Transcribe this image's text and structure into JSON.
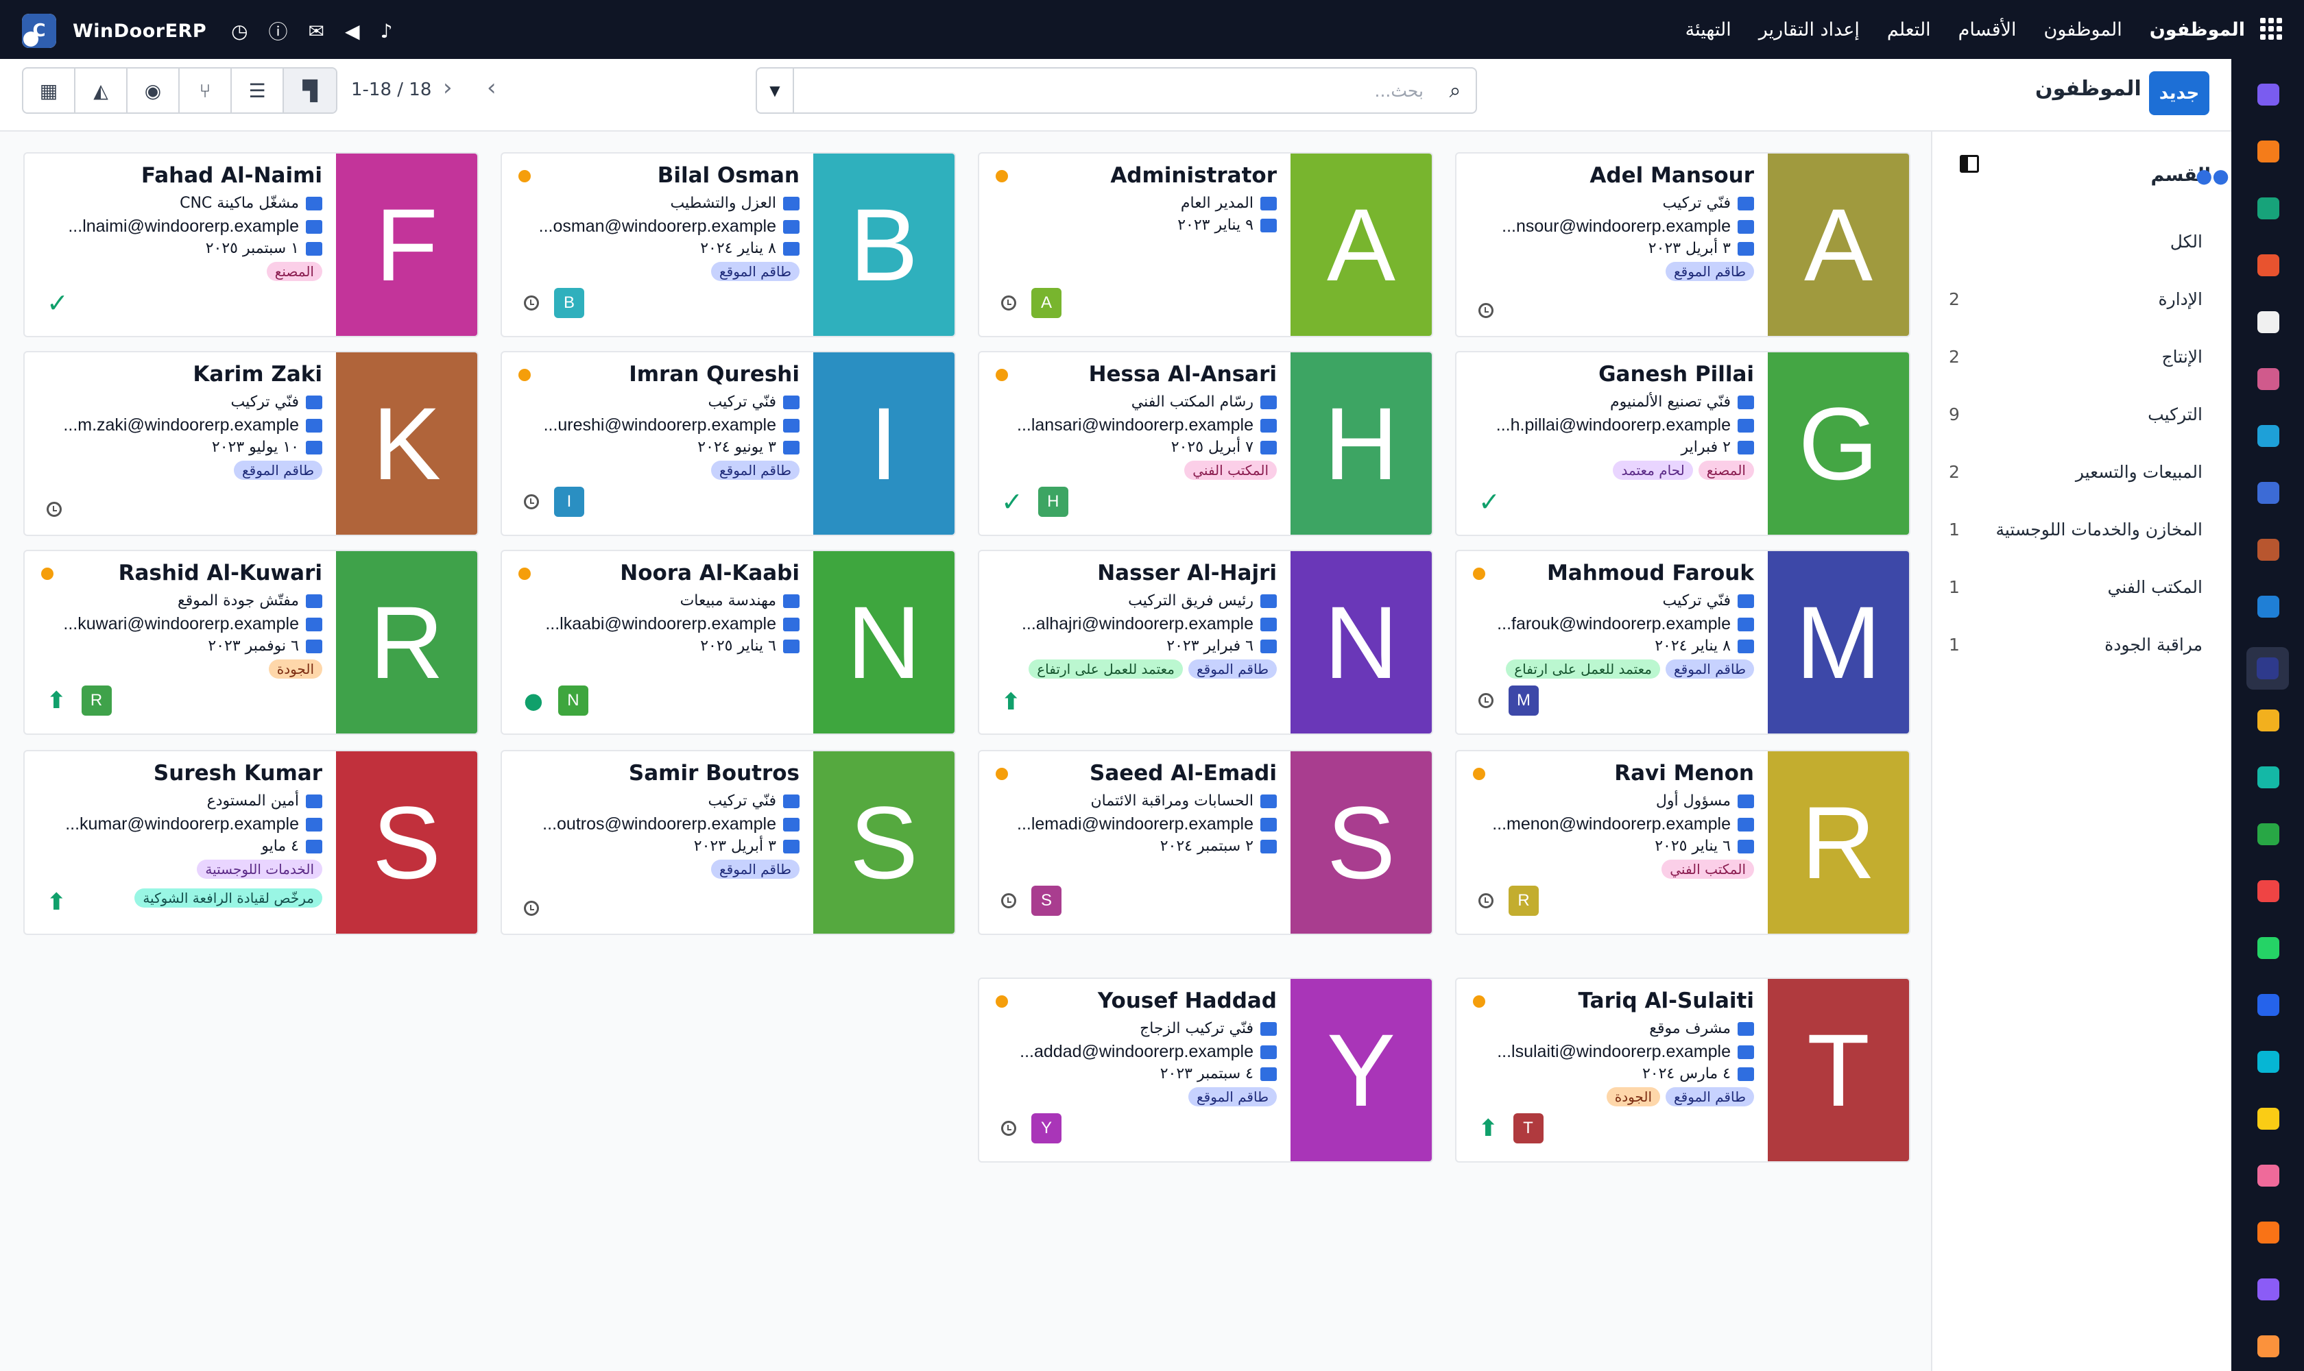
{
  "topbar": {
    "brand": "WinDoorERP",
    "menu": [
      "الموظفون",
      "الموظفون",
      "الأقسام",
      "التعلم",
      "إعداد التقارير",
      "التهيئة"
    ],
    "icons": [
      "clock-icon",
      "help-icon",
      "chat-icon",
      "megaphone-icon",
      "bell-icon",
      "apps-grid-icon"
    ]
  },
  "control": {
    "new_label": "جديد",
    "title": "الموظفون",
    "search_placeholder": "بحث...",
    "pager": "1-18 / 18",
    "views": [
      "table-icon",
      "graph-icon",
      "activity-icon",
      "hierarchy-icon",
      "list-icon",
      "kanban-icon"
    ]
  },
  "sidebar": {
    "heading": "القسم",
    "items": [
      {
        "label": "الكل",
        "count": ""
      },
      {
        "label": "الإدارة",
        "count": "2"
      },
      {
        "label": "الإنتاج",
        "count": "2"
      },
      {
        "label": "التركيب",
        "count": "9"
      },
      {
        "label": "المبيعات والتسعير",
        "count": "2"
      },
      {
        "label": "المخازن والخدمات اللوجستية",
        "count": "1"
      },
      {
        "label": "المكتب الفني",
        "count": "1"
      },
      {
        "label": "مراقبة الجودة",
        "count": "1"
      }
    ]
  },
  "cards": [
    {
      "name": "Adel Mansour",
      "initial": "A",
      "color": "#a09a3e",
      "job": "فنّي تركيب",
      "email": "...nsour@windoorerp.example",
      "date": "٣ أبريل ٢٠٢٣",
      "tags": [
        {
          "t": "طاقم الموقع",
          "c": "blue"
        }
      ],
      "tags2": [],
      "status": "",
      "extra": "clock",
      "mini": ""
    },
    {
      "name": "Administrator",
      "initial": "A",
      "color": "#78b52e",
      "job": "المدير العام",
      "email": "",
      "date": "٩ يناير ٢٠٢٣",
      "tags": [],
      "tags2": [],
      "status": "dot",
      "extra": "clock",
      "mini": "#78b52e"
    },
    {
      "name": "Bilal Osman",
      "initial": "B",
      "color": "#2fb0bd",
      "job": "العزل والتشطيب",
      "email": "...osman@windoorerp.example",
      "date": "٨ يناير ٢٠٢٤",
      "tags": [
        {
          "t": "طاقم الموقع",
          "c": "blue"
        }
      ],
      "tags2": [],
      "status": "dot",
      "extra": "clock",
      "mini": "#2fb0bd"
    },
    {
      "name": "Fahad Al-Naimi",
      "initial": "F",
      "color": "#c3349a",
      "job": "مشغّل ماكينة CNC",
      "email": "...lnaimi@windoorerp.example",
      "date": "١ سبتمبر ٢٠٢٥",
      "tags": [
        {
          "t": "المصنع",
          "c": "pink"
        }
      ],
      "tags2": [],
      "status": "",
      "extra": "check",
      "mini": ""
    },
    {
      "name": "Ganesh Pillai",
      "initial": "G",
      "color": "#44a644",
      "job": "فنّي تصنيع الألمنيوم",
      "email": "...h.pillai@windoorerp.example",
      "date": "٢ فبراير",
      "tags": [
        {
          "t": "المصنع",
          "c": "pink"
        },
        {
          "t": "لحام معتمد",
          "c": "lav"
        }
      ],
      "tags2": [],
      "status": "",
      "extra": "check",
      "mini": ""
    },
    {
      "name": "Hessa Al-Ansari",
      "initial": "H",
      "color": "#3da563",
      "job": "رسّام المكتب الفني",
      "email": "...lansari@windoorerp.example",
      "date": "٧ أبريل ٢٠٢٥",
      "tags": [
        {
          "t": "المكتب الفني",
          "c": "pink"
        }
      ],
      "tags2": [],
      "status": "dot",
      "extra": "check",
      "mini": "#3da563"
    },
    {
      "name": "Imran Qureshi",
      "initial": "I",
      "color": "#2a8fc2",
      "job": "فنّي تركيب",
      "email": "...ureshi@windoorerp.example",
      "date": "٣ يونيو ٢٠٢٤",
      "tags": [
        {
          "t": "طاقم الموقع",
          "c": "blue"
        }
      ],
      "tags2": [],
      "status": "dot",
      "extra": "clock",
      "mini": "#2a8fc2"
    },
    {
      "name": "Karim Zaki",
      "initial": "K",
      "color": "#b0643a",
      "job": "فنّي تركيب",
      "email": "...m.zaki@windoorerp.example",
      "date": "١٠ يوليو ٢٠٢٣",
      "tags": [
        {
          "t": "طاقم الموقع",
          "c": "blue"
        }
      ],
      "tags2": [],
      "status": "",
      "extra": "clock",
      "mini": ""
    },
    {
      "name": "Mahmoud Farouk",
      "initial": "M",
      "color": "#3d48a8",
      "job": "فنّي تركيب",
      "email": "...farouk@windoorerp.example",
      "date": "٨ يناير ٢٠٢٤",
      "tags": [
        {
          "t": "طاقم الموقع",
          "c": "blue"
        },
        {
          "t": "معتمد للعمل على ارتفاع",
          "c": "green"
        }
      ],
      "tags2": [],
      "status": "dot",
      "extra": "clock",
      "mini": "#3d48a8"
    },
    {
      "name": "Nasser Al-Hajri",
      "initial": "N",
      "color": "#6a37b8",
      "job": "رئيس فريق التركيب",
      "email": "...alhajri@windoorerp.example",
      "date": "٦ فبراير ٢٠٢٣",
      "tags": [
        {
          "t": "طاقم الموقع",
          "c": "blue"
        },
        {
          "t": "معتمد للعمل على ارتفاع",
          "c": "green"
        }
      ],
      "tags2": [],
      "status": "",
      "extra": "upload",
      "mini": ""
    },
    {
      "name": "Noora Al-Kaabi",
      "initial": "N",
      "color": "#3ea63e",
      "job": "مهندسة مبيعات",
      "email": "...lkaabi@windoorerp.example",
      "date": "٦ يناير ٢٠٢٥",
      "tags": [],
      "tags2": [],
      "status": "dot",
      "extra": "group",
      "mini": "#3ea63e"
    },
    {
      "name": "Rashid Al-Kuwari",
      "initial": "R",
      "color": "#3fa24a",
      "job": "مفتّش جودة الموقع",
      "email": "...kuwari@windoorerp.example",
      "date": "٦ نوفمبر ٢٠٢٣",
      "tags": [
        {
          "t": "الجودة",
          "c": "orange"
        }
      ],
      "tags2": [],
      "status": "dot",
      "extra": "upload",
      "mini": "#3fa24a"
    },
    {
      "name": "Ravi Menon",
      "initial": "R",
      "color": "#c3ad2f",
      "job": "مسؤول أول",
      "email": "...menon@windoorerp.example",
      "date": "٦ يناير ٢٠٢٥",
      "tags": [
        {
          "t": "المكتب الفني",
          "c": "pink"
        }
      ],
      "tags2": [],
      "status": "dot",
      "extra": "clock",
      "mini": "#c3ad2f"
    },
    {
      "name": "Saeed Al-Emadi",
      "initial": "S",
      "color": "#a93d8f",
      "job": "الحسابات ومراقبة الائتمان",
      "email": "...lemadi@windoorerp.example",
      "date": "٢ سبتمبر ٢٠٢٤",
      "tags": [],
      "tags2": [],
      "status": "dot",
      "extra": "clock",
      "mini": "#a93d8f"
    },
    {
      "name": "Samir Boutros",
      "initial": "S",
      "color": "#55a93f",
      "job": "فنّي تركيب",
      "email": "...outros@windoorerp.example",
      "date": "٣ أبريل ٢٠٢٣",
      "tags": [
        {
          "t": "طاقم الموقع",
          "c": "blue"
        }
      ],
      "tags2": [],
      "status": "",
      "extra": "clock",
      "mini": ""
    },
    {
      "name": "Suresh Kumar",
      "initial": "S",
      "color": "#c1303c",
      "job": "أمين المستودع",
      "email": "...kumar@windoorerp.example",
      "date": "٤ مايو",
      "tags": [
        {
          "t": "الخدمات اللوجستية",
          "c": "lav"
        }
      ],
      "tags2": [
        {
          "t": "مرخّص لقيادة الرافعة الشوكية",
          "c": "teal"
        }
      ],
      "status": "",
      "extra": "upload",
      "mini": ""
    },
    {
      "name": "Tariq Al-Sulaiti",
      "initial": "T",
      "color": "#b03a3e",
      "job": "مشرف موقع",
      "email": "...lsulaiti@windoorerp.example",
      "date": "٤ مارس ٢٠٢٤",
      "tags": [
        {
          "t": "طاقم الموقع",
          "c": "blue"
        },
        {
          "t": "الجودة",
          "c": "orange"
        }
      ],
      "tags2": [],
      "status": "dot",
      "extra": "upload",
      "mini": "#b03a3e"
    },
    {
      "name": "Yousef Haddad",
      "initial": "Y",
      "color": "#a935b8",
      "job": "فنّي تركيب الزجاج",
      "email": "...addad@windoorerp.example",
      "date": "٤ سبتمبر ٢٠٢٣",
      "tags": [
        {
          "t": "طاقم الموقع",
          "c": "blue"
        }
      ],
      "tags2": [],
      "status": "dot",
      "extra": "clock",
      "mini": "#a935b8"
    }
  ]
}
